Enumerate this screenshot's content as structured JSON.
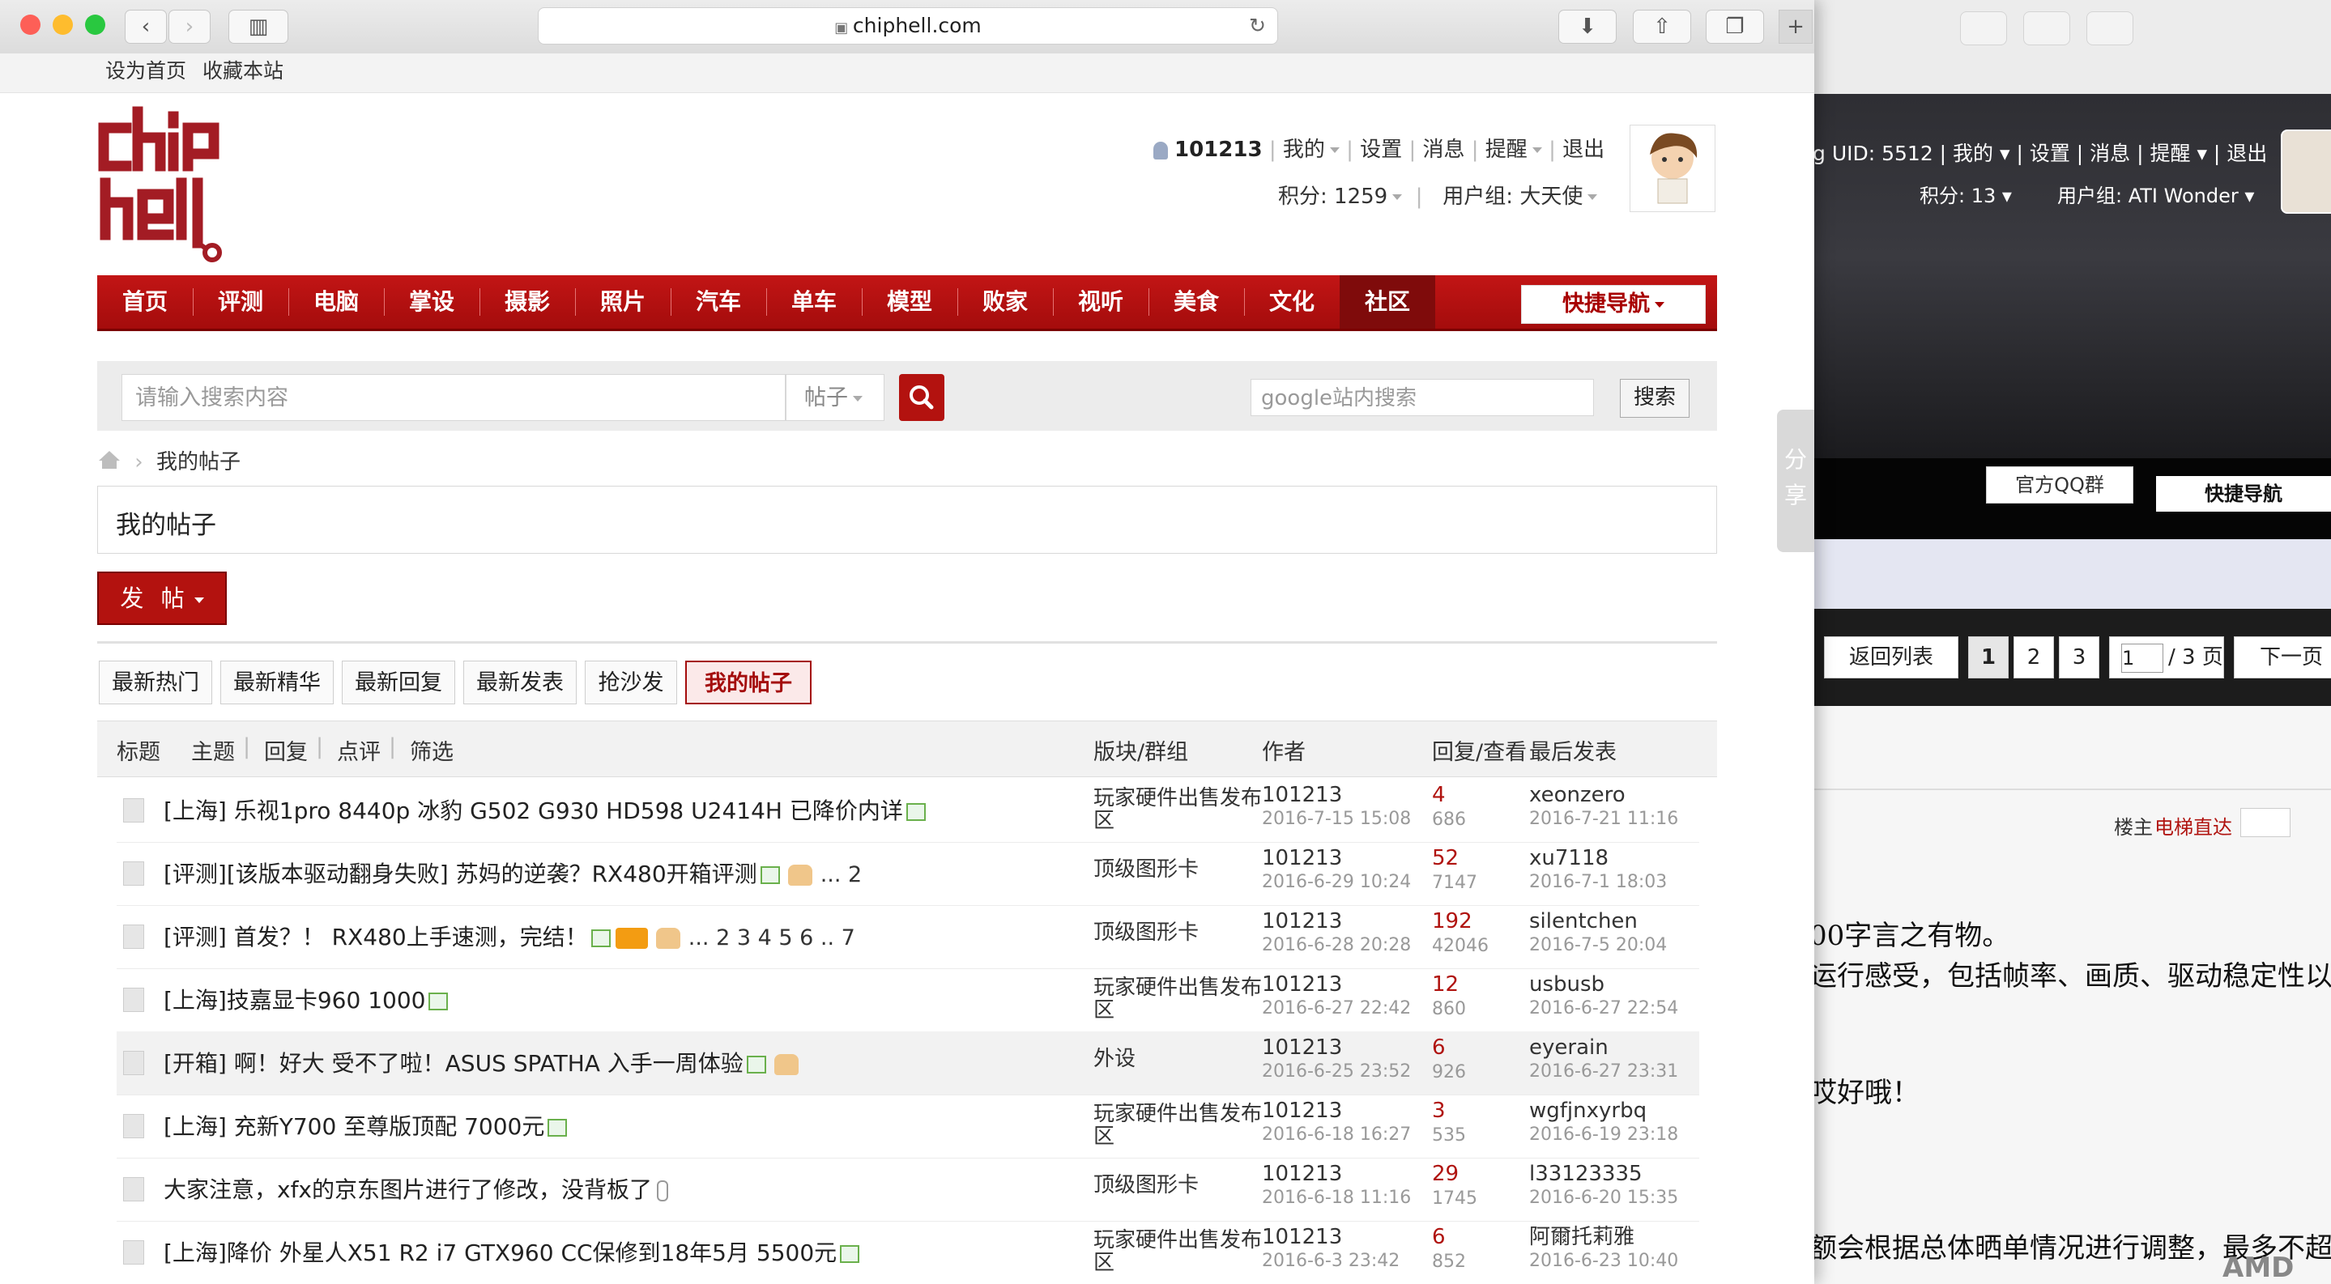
{
  "browser": {
    "url": "chiphell.com"
  },
  "topbar": {
    "set_home": "设为首页",
    "bookmark": "收藏本站"
  },
  "user": {
    "uid": "101213",
    "mine": "我的",
    "settings": "设置",
    "messages": "消息",
    "reminders": "提醒",
    "logout": "退出",
    "points": "积分: 1259",
    "group": "用户组: 大天使"
  },
  "nav": {
    "items": [
      "首页",
      "评测",
      "电脑",
      "掌设",
      "摄影",
      "照片",
      "汽车",
      "单车",
      "模型",
      "败家",
      "视听",
      "美食",
      "文化",
      "社区"
    ],
    "quick_nav": "快捷导航"
  },
  "search": {
    "placeholder": "请输入搜索内容",
    "type": "帖子",
    "google_placeholder": "google站内搜索",
    "google_button": "搜索"
  },
  "breadcrumb": {
    "current": "我的帖子"
  },
  "page_title": "我的帖子",
  "post_button": "发 帖",
  "filters": [
    "最新热门",
    "最新精华",
    "最新回复",
    "最新发表",
    "抢沙发",
    "我的帖子"
  ],
  "table": {
    "headers": {
      "title": "标题",
      "topic": "主题",
      "reply": "回复",
      "rate": "点评",
      "filter": "筛选",
      "forum": "版块/群组",
      "author": "作者",
      "stats": "回复/查看",
      "last": "最后发表"
    },
    "rows": [
      {
        "title": "[上海] 乐视1pro 8440p 冰豹 G502 G930 HD598 U2414H 已降价内详",
        "forum": "玩家硬件出售发布区",
        "author": "101213",
        "date": "2016-7-15 15:08",
        "replies": "4",
        "views": "686",
        "last_user": "xeonzero",
        "last_date": "2016-7-21 11:16"
      },
      {
        "title": "[评测][该版本驱动翻身失败] 苏妈的逆袭？RX480开箱评测",
        "pages": "... 2",
        "forum": "顶级图形卡",
        "author": "101213",
        "date": "2016-6-29 10:24",
        "replies": "52",
        "views": "7147",
        "last_user": "xu7118",
        "last_date": "2016-7-1 18:03"
      },
      {
        "title": "[评测] 首发？！ RX480上手速测，完结！",
        "pages": "... 2  3  4  5  6 .. 7",
        "forum": "顶级图形卡",
        "author": "101213",
        "date": "2016-6-28 20:28",
        "replies": "192",
        "views": "42046",
        "last_user": "silentchen",
        "last_date": "2016-7-5 20:04"
      },
      {
        "title": "[上海]技嘉显卡960 1000",
        "forum": "玩家硬件出售发布区",
        "author": "101213",
        "date": "2016-6-27 22:42",
        "replies": "12",
        "views": "860",
        "last_user": "usbusb",
        "last_date": "2016-6-27 22:54"
      },
      {
        "title": "[开箱] 啊！好大 受不了啦！ASUS SPATHA 入手一周体验",
        "forum": "外设",
        "author": "101213",
        "date": "2016-6-25 23:52",
        "replies": "6",
        "views": "926",
        "last_user": "eyerain",
        "last_date": "2016-6-27 23:31"
      },
      {
        "title": "[上海] 充新Y700 至尊版顶配 7000元",
        "forum": "玩家硬件出售发布区",
        "author": "101213",
        "date": "2016-6-18 16:27",
        "replies": "3",
        "views": "535",
        "last_user": "wgfjnxyrbq",
        "last_date": "2016-6-19 23:18"
      },
      {
        "title": "大家注意，xfx的京东图片进行了修改，没背板了",
        "forum": "顶级图形卡",
        "author": "101213",
        "date": "2016-6-18 11:16",
        "replies": "29",
        "views": "1745",
        "last_user": "l33123335",
        "last_date": "2016-6-20 15:35"
      },
      {
        "title": "[上海]降价 外星人X51 R2 i7 GTX960 CC保修到18年5月 5500元",
        "forum": "玩家硬件出售发布区",
        "author": "101213",
        "date": "2016-6-3 23:42",
        "replies": "6",
        "views": "852",
        "last_user": "阿爾托莉雅",
        "last_date": "2016-6-23 10:40"
      }
    ]
  },
  "share_tab": "分享",
  "background_window": {
    "user_bar": "g UID: 5512 | 我的 ▾ | 设置 | 消息 | 提醒 ▾ | 退出",
    "points": "积分: 13 ▾",
    "group": "用户组: ATI Wonder ▾",
    "qq_group": "官方QQ群",
    "quick_nav": "快捷导航",
    "back_list": "返回列表",
    "pages": [
      "1",
      "2",
      "3"
    ],
    "page_input": "1",
    "page_total": "/ 3 页",
    "next_page": "下一页",
    "op_label": "楼主",
    "elevator": "电梯直达",
    "text_lines": [
      "00字言之有物。",
      "运行感受，包括帧率、画质、驱动稳定性以",
      "哎好哦！",
      "额会根据总体晒单情况进行调整，最多不超"
    ],
    "brand": "AMD"
  },
  "colors": {
    "brand_red": "#b3120f",
    "nav_dark": "#7f0b0b",
    "reply_red": "#b0130f"
  }
}
